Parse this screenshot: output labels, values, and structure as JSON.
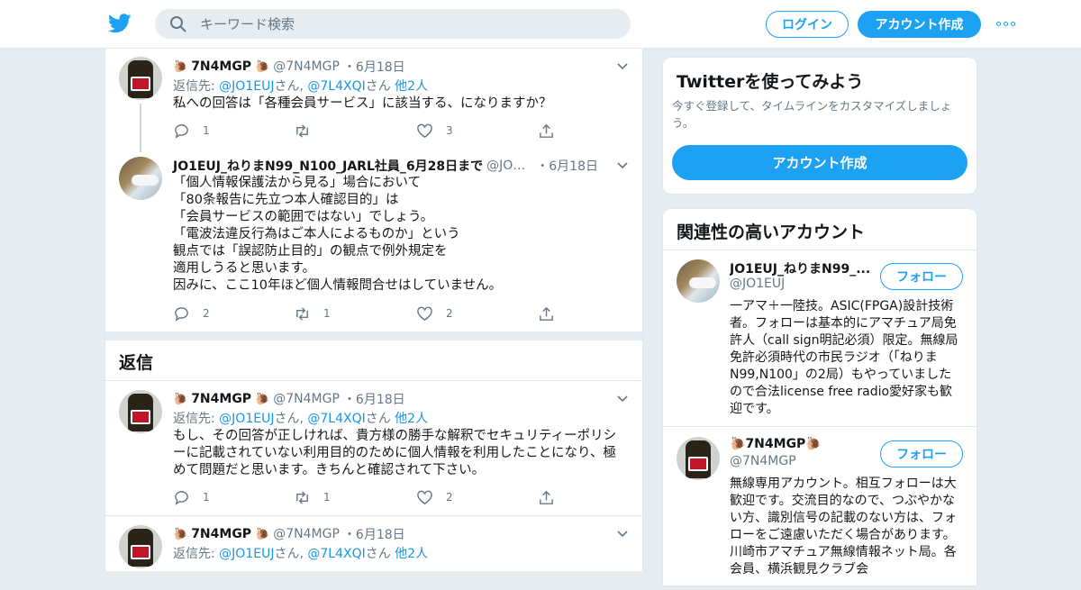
{
  "header": {
    "search_placeholder": "キーワード検索",
    "login_label": "ログイン",
    "signup_label": "アカウント作成",
    "brand_color": "#1da1f2"
  },
  "tweets": [
    {
      "name": "7N4MGP",
      "screen": "@7N4MGP",
      "date": "・6月18日",
      "reply_prefix": "返信先:",
      "reply_user1": "@JO1EUJ",
      "reply_san1": "さん,",
      "reply_user2": "@7L4XQI",
      "reply_san2": "さん",
      "reply_more": "他2人",
      "text": "私への回答は「各種会員サービス」に該当する、になりますか？",
      "replies": "1",
      "retweets": "",
      "likes": "3"
    },
    {
      "name": "JO1EUJ_ねりまN99_N100_JARL社員_6月28日まで",
      "screen": "@JO…",
      "date": "・6月18日",
      "text": "「個人情報保護法から見る」場合において\n「80条報告に先立つ本人確認目的」は\n「会員サービスの範囲ではない」でしょう。\n「電波法違反行為はご本人によるものか」という\n観点では「誤認防止目的」の観点で例外規定を\n適用しうると思います。\n因みに、ここ10年ほど個人情報問合せはしていません。",
      "replies": "2",
      "retweets": "1",
      "likes": "2"
    },
    {
      "name": "7N4MGP",
      "screen": "@7N4MGP",
      "date": "・6月18日",
      "reply_prefix": "返信先:",
      "reply_user1": "@JO1EUJ",
      "reply_san1": "さん,",
      "reply_user2": "@7L4XQI",
      "reply_san2": "さん",
      "reply_more": "他2人",
      "text": "もし、その回答が正しければ、貴方様の勝手な解釈でセキュリティーポリシーに記載されていない利用目的のために個人情報を利用したことになり、極めて問題だと思います。きちんと確認されて下さい。",
      "replies": "1",
      "retweets": "1",
      "likes": "2"
    },
    {
      "name": "7N4MGP",
      "screen": "@7N4MGP",
      "date": "・6月18日",
      "reply_prefix": "返信先:",
      "reply_user1": "@JO1EUJ",
      "reply_san1": "さん,",
      "reply_user2": "@7L4XQI",
      "reply_san2": "さん",
      "reply_more": "他2人"
    }
  ],
  "replies_section_title": "返信",
  "signup_card": {
    "title": "Twitterを使ってみよう",
    "subtitle": "今すぐ登録して、タイムラインをカスタマイズしましょう。",
    "button": "アカウント作成"
  },
  "related": {
    "title": "関連性の高いアカウント",
    "follow_label": "フォロー",
    "accounts": [
      {
        "name": "JO1EUJ_ねりまN99_...",
        "handle": "@JO1EUJ",
        "bio": "一アマ＋一陸技。ASIC(FPGA)設計技術者。フォローは基本的にアマチュア局免許人（call sign明記必須）限定。無線局免許必須時代の市民ラジオ（「ねりまN99,N100」の2局）もやっていましたので合法license free radio愛好家も歓迎です。"
      },
      {
        "name": "7N4MGP",
        "handle": "@7N4MGP",
        "bio": "無線専用アカウント。相互フォローは大歓迎です。交流目的なので、つぶやかない方、識別信号の記載のない方は、フォローをご遠慮いただく場合があります。川崎市アマチュア無線情報ネット局。各会員、横浜観見クラブ会"
      }
    ]
  }
}
